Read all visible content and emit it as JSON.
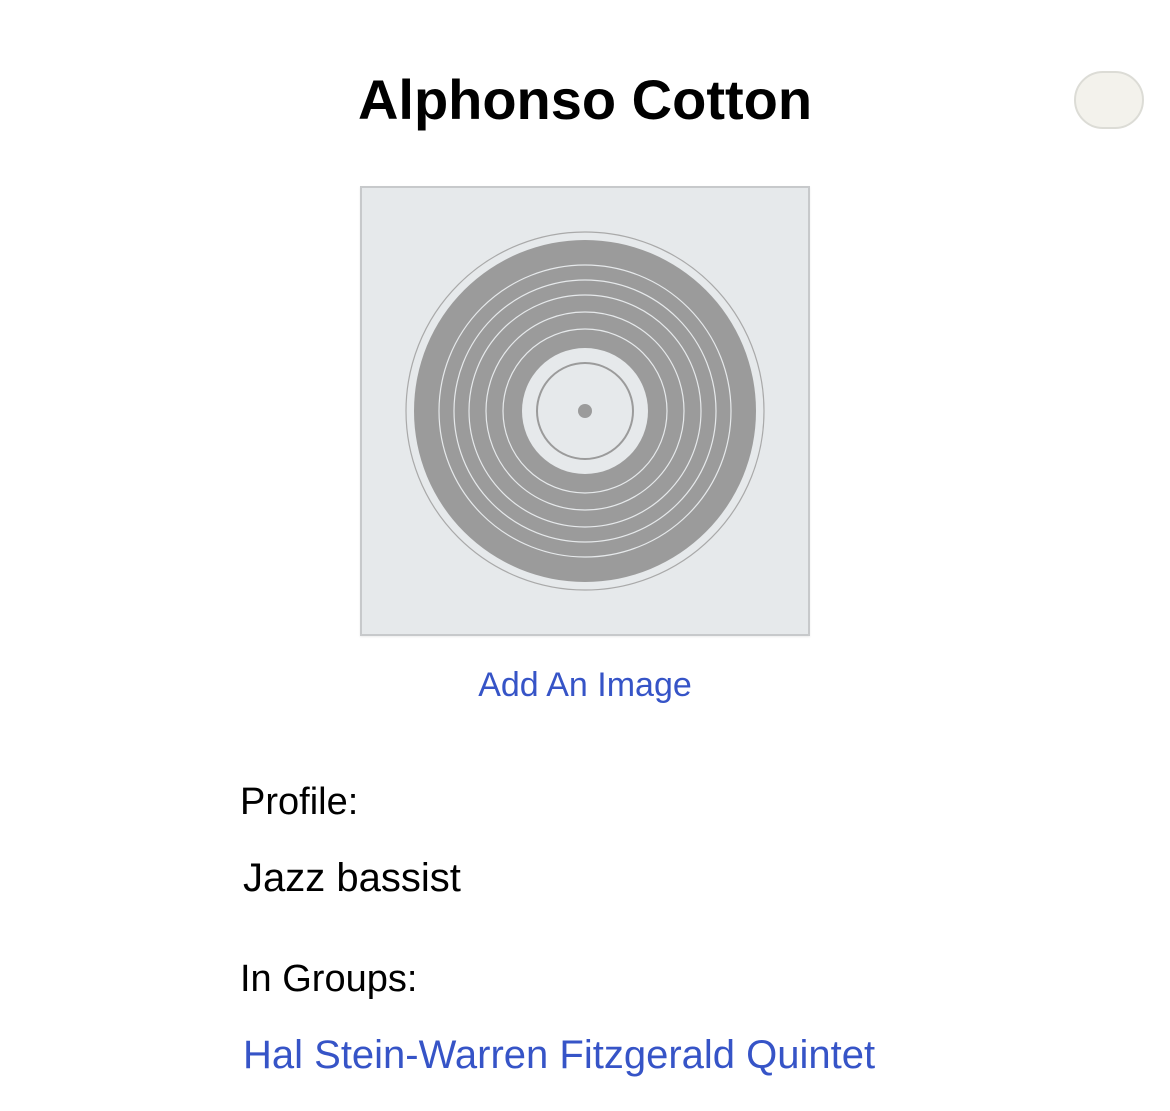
{
  "artist": {
    "name": "Alphonso Cotton"
  },
  "image": {
    "placeholder_icon": "vinyl-record-icon",
    "add_image_label": "Add An Image"
  },
  "profile": {
    "label": "Profile:",
    "text": "Jazz bassist"
  },
  "groups": {
    "label": "In Groups:",
    "items": [
      {
        "name": "Hal Stein-Warren Fitzgerald Quintet"
      }
    ]
  },
  "colors": {
    "link": "#3654c7",
    "placeholder_bg": "#e6e9eb",
    "record_gray": "#9b9b9b"
  }
}
